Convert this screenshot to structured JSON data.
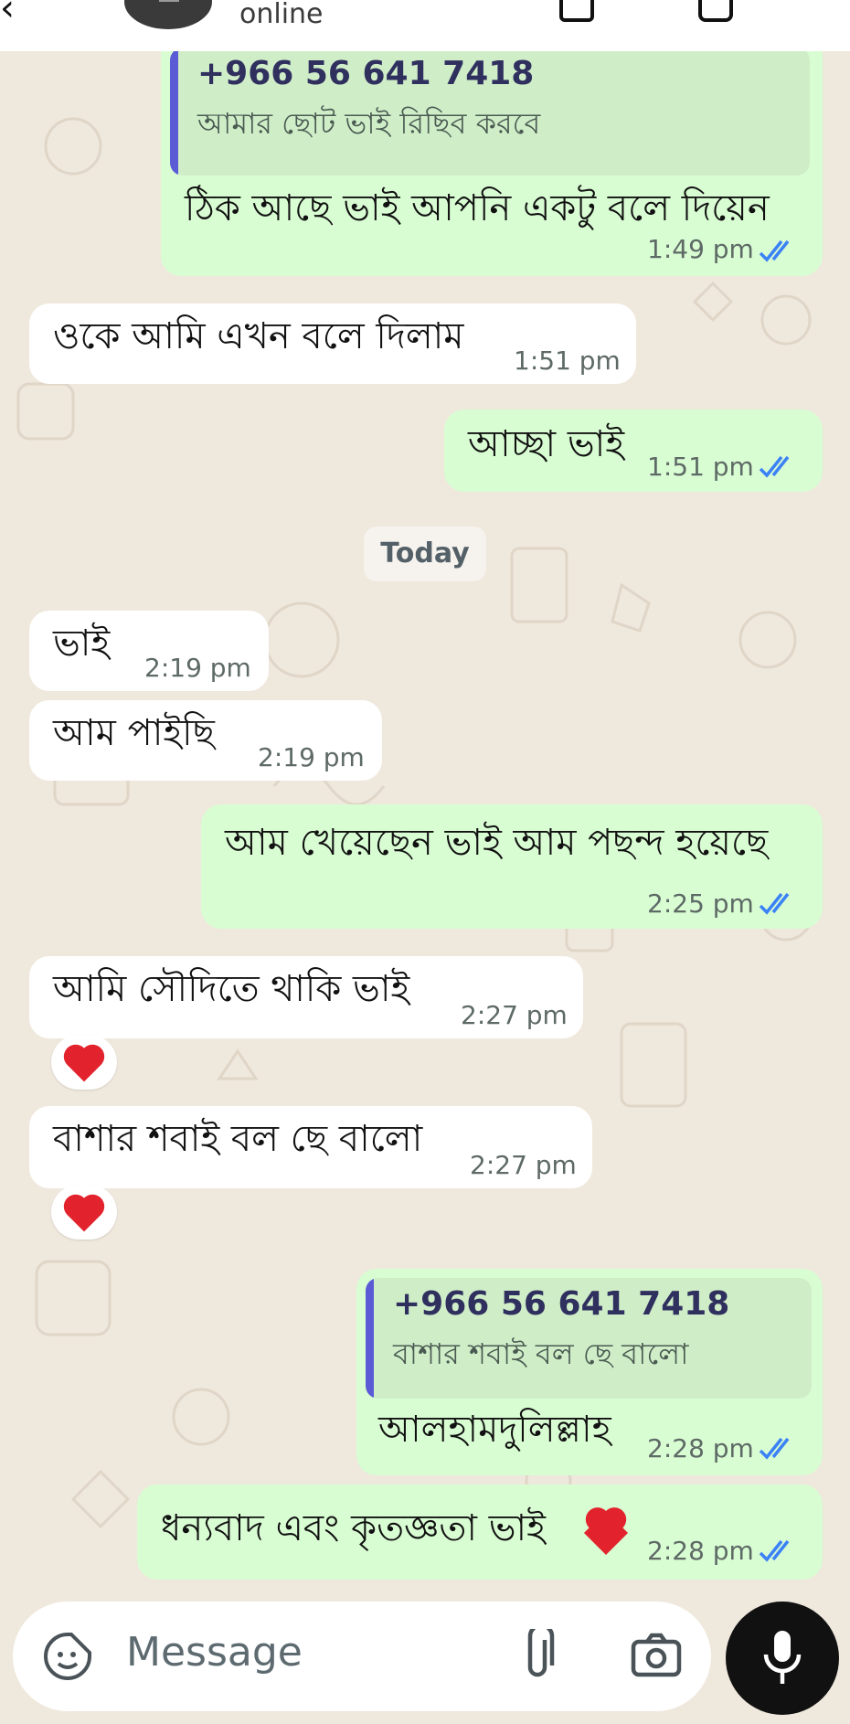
{
  "header": {
    "status": "online"
  },
  "date_divider": "Today",
  "messages": [
    {
      "direction": "outgoing",
      "quote": {
        "author": "+966 56 641 7418",
        "text": "আমার ছোট ভাই  রিছিব করবে"
      },
      "text": "ঠিক আছে ভাই আপনি একটু বলে দিয়েন",
      "time": "1:49 pm",
      "status": "read"
    },
    {
      "direction": "incoming",
      "text": "ওকে আমি এখন বলে দিলাম",
      "time": "1:51 pm"
    },
    {
      "direction": "outgoing",
      "text": "আচ্ছা ভাই",
      "time": "1:51 pm",
      "status": "read"
    },
    {
      "direction": "incoming",
      "text": "ভাই",
      "time": "2:19 pm"
    },
    {
      "direction": "incoming",
      "text": "আম পাইছি",
      "time": "2:19 pm"
    },
    {
      "direction": "outgoing",
      "text": "আম খেয়েছেন ভাই আম পছন্দ হয়েছে",
      "time": "2:25 pm",
      "status": "read"
    },
    {
      "direction": "incoming",
      "text": "আমি সৌদিতে  থাকি ভাই",
      "time": "2:27 pm",
      "reaction": "heart"
    },
    {
      "direction": "incoming",
      "text": "বাশার শবাই বল ছে বালো",
      "time": "2:27 pm",
      "reaction": "heart"
    },
    {
      "direction": "outgoing",
      "quote": {
        "author": "+966 56 641 7418",
        "text": "বাশার শবাই বল ছে বালো"
      },
      "text": "আলহামদুলিল্লাহ",
      "time": "2:28 pm",
      "status": "read"
    },
    {
      "direction": "outgoing",
      "text": "ধন্যবাদ এবং কৃতজ্ঞতা ভাই",
      "emoji": "heart",
      "time": "2:28 pm",
      "status": "read"
    }
  ],
  "composer": {
    "placeholder": "Message",
    "icons": [
      "sticker-icon",
      "attach-icon",
      "camera-icon",
      "mic-icon"
    ]
  },
  "colors": {
    "outgoing_bubble": "#d9fdd3",
    "incoming_bubble": "#ffffff",
    "read_ticks": "#3b82f6",
    "quote_bar": "#5b5bd6",
    "background": "#efe8dd",
    "heart": "#e2222d"
  }
}
